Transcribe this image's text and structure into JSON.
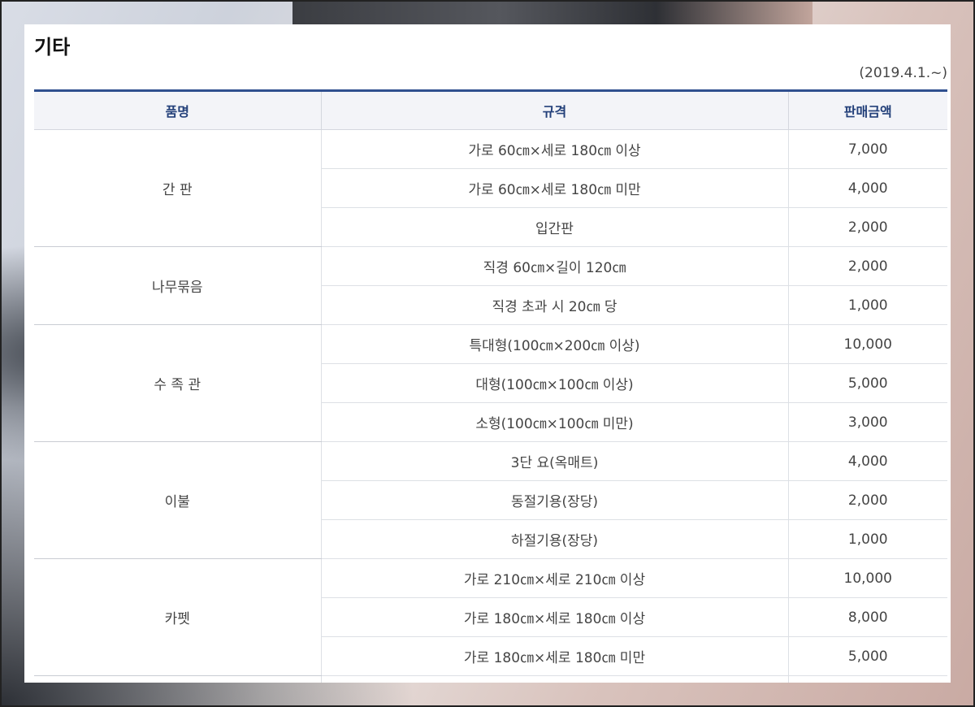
{
  "page": {
    "title": "기타",
    "date_note": "(2019.4.1.~)"
  },
  "table": {
    "headers": [
      "품명",
      "규격",
      "판매금액"
    ],
    "groups": [
      {
        "name": "간 판",
        "rows": [
          {
            "spec": "가로 60㎝×세로 180㎝ 이상",
            "price": "7,000"
          },
          {
            "spec": "가로 60㎝×세로 180㎝ 미만",
            "price": "4,000"
          },
          {
            "spec": "입간판",
            "price": "2,000"
          }
        ]
      },
      {
        "name": "나무묶음",
        "rows": [
          {
            "spec": "직경 60㎝×길이 120㎝",
            "price": "2,000"
          },
          {
            "spec": "직경 초과 시 20㎝ 당",
            "price": "1,000"
          }
        ]
      },
      {
        "name": "수 족 관",
        "rows": [
          {
            "spec": "특대형(100㎝×200㎝ 이상)",
            "price": "10,000"
          },
          {
            "spec": "대형(100㎝×100㎝ 이상)",
            "price": "5,000"
          },
          {
            "spec": "소형(100㎝×100㎝ 미만)",
            "price": "3,000"
          }
        ]
      },
      {
        "name": "이불",
        "rows": [
          {
            "spec": "3단 요(옥매트)",
            "price": "4,000"
          },
          {
            "spec": "동절기용(장당)",
            "price": "2,000"
          },
          {
            "spec": "하절기용(장당)",
            "price": "1,000"
          }
        ]
      },
      {
        "name": "카펫",
        "rows": [
          {
            "spec": "가로 210㎝×세로 210㎝ 이상",
            "price": "10,000"
          },
          {
            "spec": "가로 180㎝×세로 180㎝ 이상",
            "price": "8,000"
          },
          {
            "spec": "가로 180㎝×세로 180㎝ 미만",
            "price": "5,000"
          }
        ]
      }
    ]
  }
}
